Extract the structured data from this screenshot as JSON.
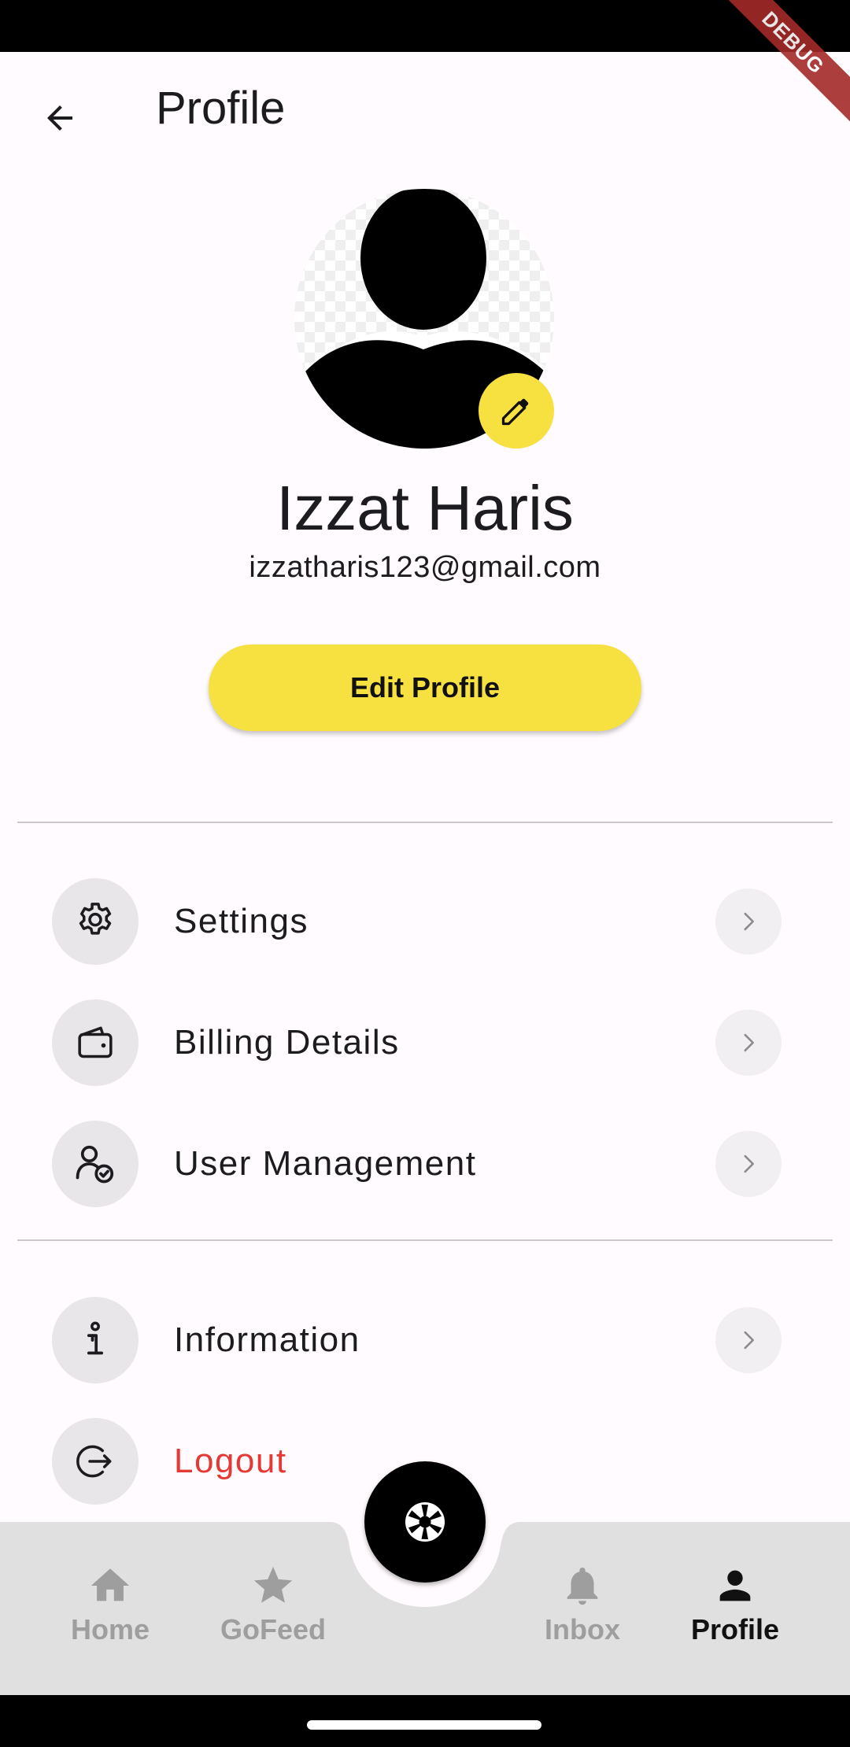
{
  "status_bar": {},
  "debug_banner": "DEBUG",
  "app_bar": {
    "title": "Profile"
  },
  "profile": {
    "name": "Izzat Haris",
    "email": "izzatharis123@gmail.com",
    "edit_button_label": "Edit Profile"
  },
  "menu": {
    "items": [
      {
        "label": "Settings",
        "icon": "gear-icon"
      },
      {
        "label": "Billing Details",
        "icon": "wallet-icon"
      },
      {
        "label": "User Management",
        "icon": "user-check-icon"
      }
    ],
    "secondary_items": [
      {
        "label": "Information",
        "icon": "info-icon"
      },
      {
        "label": "Logout",
        "icon": "logout-icon",
        "color": "#e53935"
      }
    ]
  },
  "bottom_nav": {
    "items": [
      {
        "label": "Home",
        "icon": "home-icon",
        "active": false
      },
      {
        "label": "GoFeed",
        "icon": "star-icon",
        "active": false
      },
      {
        "label": "Inbox",
        "icon": "bell-icon",
        "active": false
      },
      {
        "label": "Profile",
        "icon": "person-icon",
        "active": true
      }
    ],
    "fab_icon": "camera-shutter-icon"
  },
  "colors": {
    "accent_yellow": "#f7e140",
    "background": "#fffbfe",
    "nav_background": "#e0e0e0",
    "logout_red": "#e53935"
  }
}
